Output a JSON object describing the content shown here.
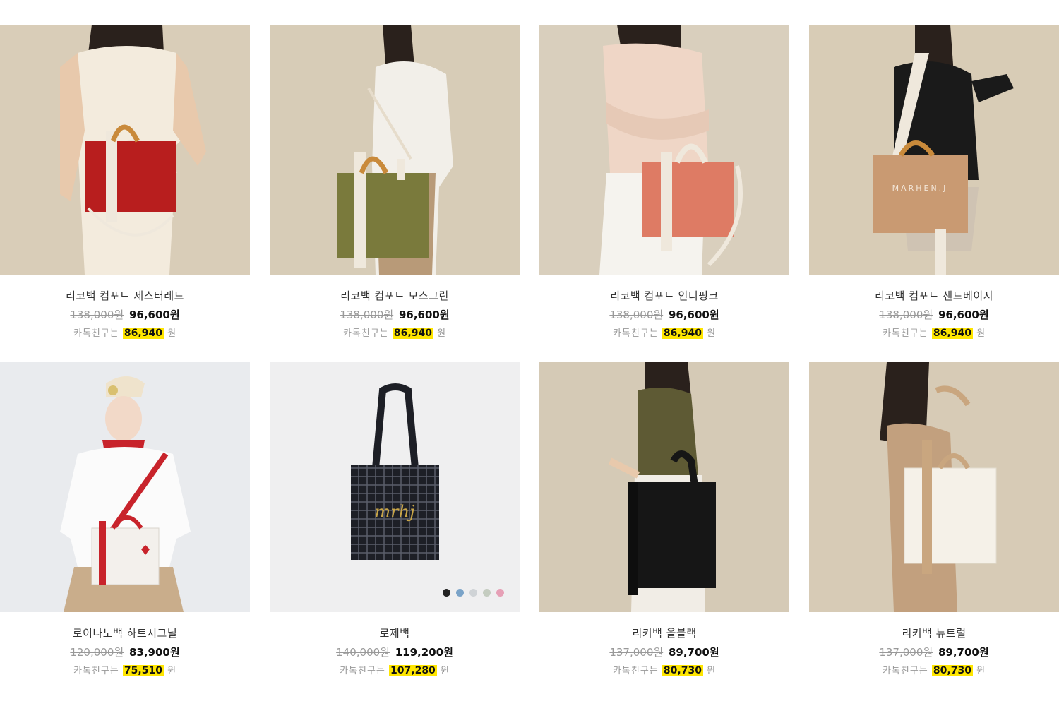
{
  "products": [
    {
      "name": "리코백 컴포트 제스터레드",
      "original_price": "138,000원",
      "sale_price": "96,600원",
      "kakao_label": "카톡친구는",
      "kakao_price": "86,940",
      "kakao_unit": "원",
      "bag_color": "#b81e1e",
      "bg_color": "#d9cdb8",
      "icon": "red-tote-bag-photo"
    },
    {
      "name": "리코백 컴포트 모스그린",
      "original_price": "138,000원",
      "sale_price": "96,600원",
      "kakao_label": "카톡친구는",
      "kakao_price": "86,940",
      "kakao_unit": "원",
      "bag_color": "#7a7a3c",
      "bg_color": "#d7ccb7",
      "icon": "moss-green-tote-bag-photo"
    },
    {
      "name": "리코백 컴포트 인디핑크",
      "original_price": "138,000원",
      "sale_price": "96,600원",
      "kakao_label": "카톡친구는",
      "kakao_price": "86,940",
      "kakao_unit": "원",
      "bag_color": "#de7b64",
      "bg_color": "#d9cfbd",
      "icon": "indi-pink-tote-bag-photo"
    },
    {
      "name": "리코백 컴포트 샌드베이지",
      "original_price": "138,000원",
      "sale_price": "96,600원",
      "kakao_label": "카톡친구는",
      "kakao_price": "86,940",
      "kakao_unit": "원",
      "bag_color": "#c99a72",
      "bg_color": "#d8ccb6",
      "icon": "sand-beige-tote-bag-photo",
      "bag_text": "MARHEN.J"
    },
    {
      "name": "로이나노백 하트시그널",
      "original_price": "120,000원",
      "sale_price": "83,900원",
      "kakao_label": "카톡친구는",
      "kakao_price": "75,510",
      "kakao_unit": "원",
      "bag_color": "#f3f0ec",
      "bg_color": "#e9ebee",
      "icon": "heart-signal-mini-bag-photo"
    },
    {
      "name": "로제백",
      "original_price": "140,000원",
      "sale_price": "119,200원",
      "kakao_label": "카톡친구는",
      "kakao_price": "107,280",
      "kakao_unit": "원",
      "bag_color": "#1d1f26",
      "bg_color": "#efeff0",
      "icon": "tweed-tote-bag-photo",
      "bag_text": "mrhj",
      "swatches": [
        "#222222",
        "#7aa3c8",
        "#cfd3d6",
        "#c4ccc0",
        "#e6a0b6"
      ]
    },
    {
      "name": "리키백 올블랙",
      "original_price": "137,000원",
      "sale_price": "89,700원",
      "kakao_label": "카톡친구는",
      "kakao_price": "80,730",
      "kakao_unit": "원",
      "bag_color": "#161616",
      "bg_color": "#d5cab6",
      "icon": "all-black-tote-bag-photo"
    },
    {
      "name": "리키백 뉴트럴",
      "original_price": "137,000원",
      "sale_price": "89,700원",
      "kakao_label": "카톡친구는",
      "kakao_price": "80,730",
      "kakao_unit": "원",
      "bag_color": "#f5f1e8",
      "bg_color": "#d7cbb6",
      "icon": "neutral-tote-bag-photo"
    }
  ]
}
